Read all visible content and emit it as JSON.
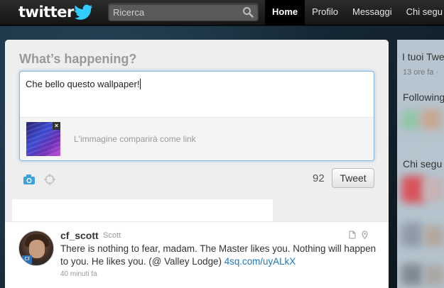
{
  "header": {
    "logo_text": "twitter",
    "search_placeholder": "Ricerca",
    "nav": [
      {
        "label": "Home",
        "active": true
      },
      {
        "label": "Profilo"
      },
      {
        "label": "Messaggi"
      },
      {
        "label": "Chi segu"
      }
    ]
  },
  "composer": {
    "prompt": "What’s happening?",
    "text": "Che bello questo wallpaper!",
    "attachment_close": "×",
    "attachment_label": "L'immagine comparirà come link",
    "char_count": "92",
    "tweet_button": "Tweet",
    "tool_icons": [
      "camera-icon",
      "location-crosshair-icon"
    ]
  },
  "stream": {
    "tweet": {
      "screen_name": "cf_scott",
      "full_name": "Scott",
      "text": "There is nothing to fear, madam. The Master likes you. Nothing will happen to you. He likes you. (@ Valley Lodge) ",
      "link": "4sq.com/uyALkX",
      "time": "40 minuti fa",
      "avatar_badge": "Cf"
    }
  },
  "dashboard": {
    "title": "I tuoi Twe",
    "subtitle": "13 ore fa ·",
    "following": "Following",
    "who_to_follow": "Chi segu"
  },
  "colors": {
    "accent_blue": "#2276bb",
    "twitter_bird": "#33ccff",
    "focus_border": "#86b8e0"
  }
}
